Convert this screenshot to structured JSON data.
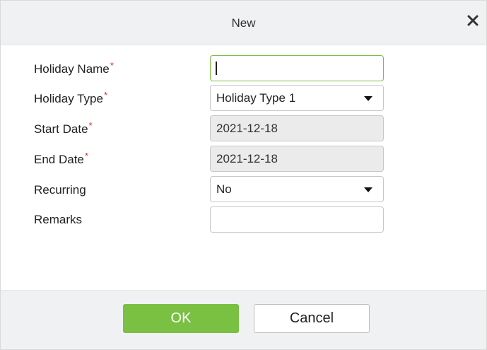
{
  "dialog": {
    "title": "New",
    "close_icon": "close-icon"
  },
  "form": {
    "required_marker": "*",
    "holiday_name": {
      "label": "Holiday Name",
      "value": ""
    },
    "holiday_type": {
      "label": "Holiday Type",
      "value": "Holiday Type 1"
    },
    "start_date": {
      "label": "Start Date",
      "value": "2021-12-18"
    },
    "end_date": {
      "label": "End Date",
      "value": "2021-12-18"
    },
    "recurring": {
      "label": "Recurring",
      "value": "No"
    },
    "remarks": {
      "label": "Remarks",
      "value": ""
    }
  },
  "buttons": {
    "ok_label": "OK",
    "cancel_label": "Cancel"
  },
  "colors": {
    "accent": "#79c043",
    "required": "#e5322d",
    "header_bg": "#f0f1f3",
    "readonly_bg": "#ebebeb"
  }
}
